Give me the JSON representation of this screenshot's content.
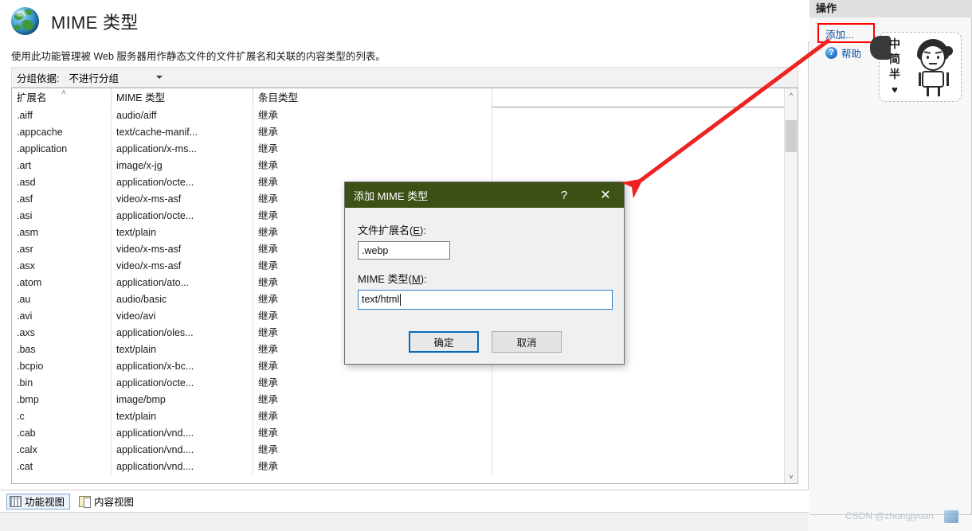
{
  "header": {
    "title": "MIME 类型",
    "description": "使用此功能管理被 Web 服务器用作静态文件的文件扩展名和关联的内容类型的列表。",
    "icon": "globe-icon"
  },
  "toolbar": {
    "groupby_label": "分组依据:",
    "groupby_value": "不进行分组",
    "caret_icon": "chevron-down-icon"
  },
  "grid": {
    "columns": [
      "扩展名",
      "MIME 类型",
      "条目类型"
    ],
    "sort_column": "扩展名",
    "sort_indicator": "˄",
    "rows": [
      {
        "ext": ".aiff",
        "mime": "audio/aiff",
        "type": "继承"
      },
      {
        "ext": ".appcache",
        "mime": "text/cache-manif...",
        "type": "继承"
      },
      {
        "ext": ".application",
        "mime": "application/x-ms...",
        "type": "继承"
      },
      {
        "ext": ".art",
        "mime": "image/x-jg",
        "type": "继承"
      },
      {
        "ext": ".asd",
        "mime": "application/octe...",
        "type": "继承"
      },
      {
        "ext": ".asf",
        "mime": "video/x-ms-asf",
        "type": "继承"
      },
      {
        "ext": ".asi",
        "mime": "application/octe...",
        "type": "继承"
      },
      {
        "ext": ".asm",
        "mime": "text/plain",
        "type": "继承"
      },
      {
        "ext": ".asr",
        "mime": "video/x-ms-asf",
        "type": "继承"
      },
      {
        "ext": ".asx",
        "mime": "video/x-ms-asf",
        "type": "继承"
      },
      {
        "ext": ".atom",
        "mime": "application/ato...",
        "type": "继承"
      },
      {
        "ext": ".au",
        "mime": "audio/basic",
        "type": "继承"
      },
      {
        "ext": ".avi",
        "mime": "video/avi",
        "type": "继承"
      },
      {
        "ext": ".axs",
        "mime": "application/oles...",
        "type": "继承"
      },
      {
        "ext": ".bas",
        "mime": "text/plain",
        "type": "继承"
      },
      {
        "ext": ".bcpio",
        "mime": "application/x-bc...",
        "type": "继承"
      },
      {
        "ext": ".bin",
        "mime": "application/octe...",
        "type": "继承"
      },
      {
        "ext": ".bmp",
        "mime": "image/bmp",
        "type": "继承"
      },
      {
        "ext": ".c",
        "mime": "text/plain",
        "type": "继承"
      },
      {
        "ext": ".cab",
        "mime": "application/vnd....",
        "type": "继承"
      },
      {
        "ext": ".calx",
        "mime": "application/vnd....",
        "type": "继承"
      },
      {
        "ext": ".cat",
        "mime": "application/vnd....",
        "type": "继承"
      }
    ],
    "scrollbar": {
      "up_icon": "chevron-up-icon",
      "down_icon": "chevron-down-icon"
    }
  },
  "view_tabs": [
    {
      "label": "功能视图",
      "icon": "features-view-icon",
      "active": true
    },
    {
      "label": "内容视图",
      "icon": "content-view-icon",
      "active": false
    }
  ],
  "actions": {
    "title": "操作",
    "items": [
      {
        "label": "添加...",
        "icon": null,
        "highlighted": true
      },
      {
        "label": "帮助",
        "icon": "help-icon",
        "highlighted": false
      }
    ],
    "highlight_color": "#ff0000"
  },
  "ime_sticker": {
    "chars": [
      "中",
      "简",
      "半"
    ],
    "heart": "♥",
    "avatar": "cartoon-girl-avatar"
  },
  "dialog": {
    "title": "添加 MIME 类型",
    "titlebar_color": "#3d5117",
    "help_icon": "question-mark-icon",
    "close_icon": "close-icon",
    "fields": [
      {
        "label_prefix": "文件扩展名(",
        "accel": "E",
        "label_suffix": "):",
        "value": ".webp",
        "focused": false
      },
      {
        "label_prefix": "MIME 类型(",
        "accel": "M",
        "label_suffix": "):",
        "value": "text/html",
        "focused": true
      }
    ],
    "buttons": [
      {
        "label": "确定",
        "primary": true
      },
      {
        "label": "取消",
        "primary": false
      }
    ]
  },
  "annotation": {
    "type": "red-arrow",
    "color": "#ee2222",
    "from": "添加...",
    "to": "添加 MIME 类型 对话框"
  },
  "watermark": {
    "text": "CSDN @zhongjyuan"
  }
}
